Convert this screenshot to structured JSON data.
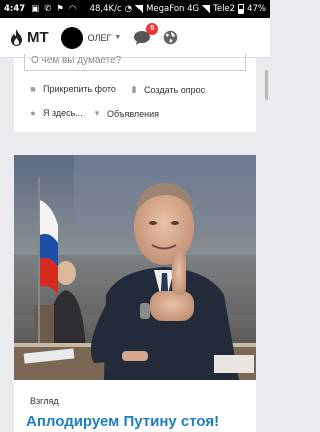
{
  "status_bar": {
    "time": "4:47",
    "speed": "48,4K/c",
    "sim1": "MegaFon 4G",
    "sim2": "Tele2",
    "battery": "47%"
  },
  "header": {
    "logo_text": "МТ",
    "username": "ОЛЕГ",
    "notification_count": "5"
  },
  "composer": {
    "placeholder": "О чем вы думаете?",
    "actions": [
      {
        "label": "Прикрепить фото",
        "icon": "camera-icon"
      },
      {
        "label": "Создать опрос",
        "icon": "bar-chart-icon"
      },
      {
        "label": "Я здесь...",
        "icon": "location-pin-icon"
      },
      {
        "label": "Объявления",
        "icon": "cart-icon"
      }
    ]
  },
  "article": {
    "category": "Взгляд",
    "headline": "Аплодируем Путину стоя!"
  },
  "colors": {
    "accent": "#1e7fc0",
    "badge": "#e53935"
  }
}
